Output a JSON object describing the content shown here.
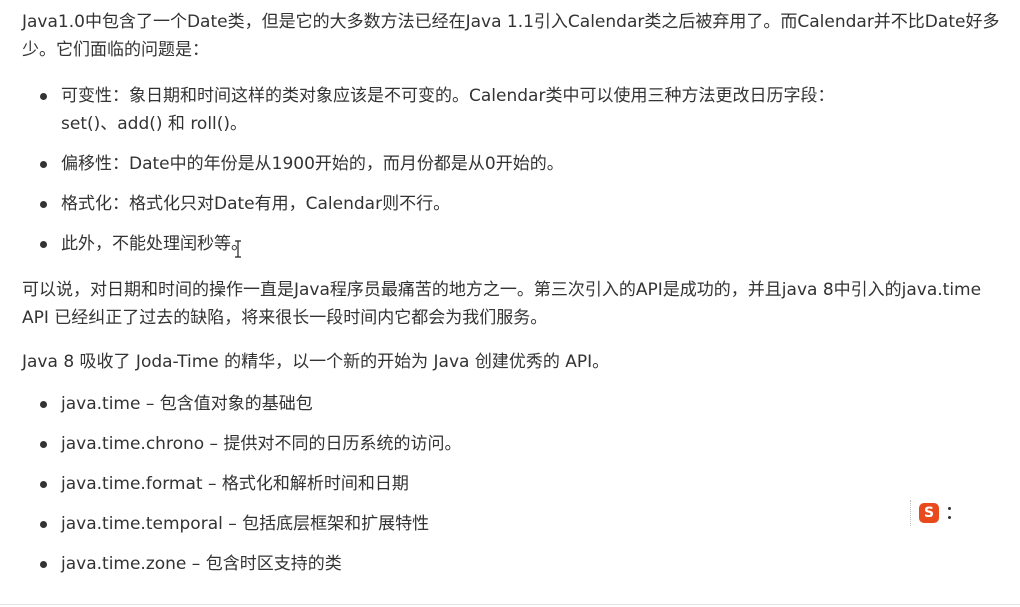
{
  "paragraphs": {
    "p1": "Java1.0中包含了一个Date类，但是它的大多数方法已经在Java 1.1引入Calendar类之后被弃用了。而Calendar并不比Date好多少。它们面临的问题是：",
    "p2": "可以说，对日期和时间的操作一直是Java程序员最痛苦的地方之一。第三次引入的API是成功的，并且java 8中引入的java.time API 已经纠正了过去的缺陷，将来很长一段时间内它都会为我们服务。",
    "p3": "Java 8 吸收了 Joda-Time 的精华，以一个新的开始为 Java 创建优秀的 API。"
  },
  "problems": [
    {
      "line1": "可变性：象日期和时间这样的类对象应该是不可变的。Calendar类中可以使用三种方法更改日历字段：",
      "line2": "set()、add() 和 roll()。"
    },
    {
      "line1": "偏移性：Date中的年份是从1900开始的，而月份都是从0开始的。"
    },
    {
      "line1": "格式化：格式化只对Date有用，Calendar则不行。"
    },
    {
      "line1": "此外，不能处理闰秒等。"
    }
  ],
  "packages": [
    "java.time – 包含值对象的基础包",
    "java.time.chrono – 提供对不同的日历系统的访问。",
    "java.time.format – 格式化和解析时间和日期",
    "java.time.temporal – 包括底层框架和扩展特性",
    "java.time.zone – 包含时区支持的类"
  ],
  "ime": {
    "logo_letter": "S",
    "icon": "sogou-ime-icon",
    "brand_color": "#e8491d"
  }
}
